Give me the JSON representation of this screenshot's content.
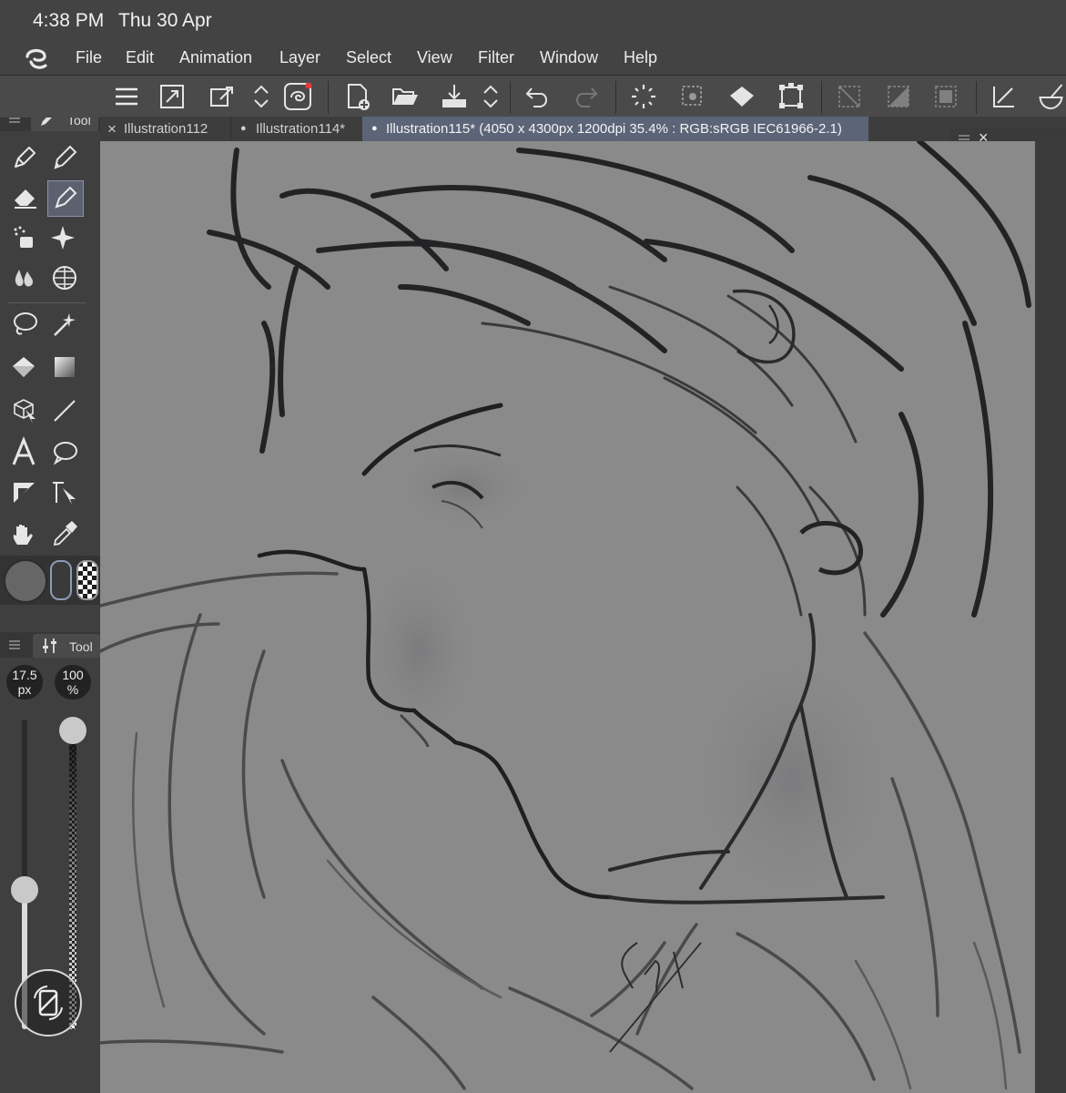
{
  "status": {
    "time": "4:38 PM",
    "date": "Thu 30 Apr"
  },
  "menu": {
    "items": [
      "File",
      "Edit",
      "Animation",
      "Layer",
      "Select",
      "View",
      "Filter",
      "Window",
      "Help"
    ]
  },
  "tabs": [
    {
      "label": "Illustration112",
      "marker": "×"
    },
    {
      "label": "Illustration114*",
      "marker": "●"
    },
    {
      "label": "Illustration115* (4050 x 4300px 1200dpi 35.4% : RGB:sRGB IEC61966-2.1)",
      "marker": "●"
    }
  ],
  "tool_panel": {
    "title": "Tool"
  },
  "tool_property_panel": {
    "title": "Tool"
  },
  "brush": {
    "size_value": "17.5",
    "size_unit": "px",
    "opacity_value": "100",
    "opacity_unit": "%",
    "size_level": 0.45,
    "opacity_level": 1.0
  },
  "floating_panel": {
    "close": "×",
    "minimize": "_"
  },
  "colors": {
    "accent": "#5c6478",
    "canvas": "#8a8a8a",
    "panel": "#3f3f3f"
  }
}
